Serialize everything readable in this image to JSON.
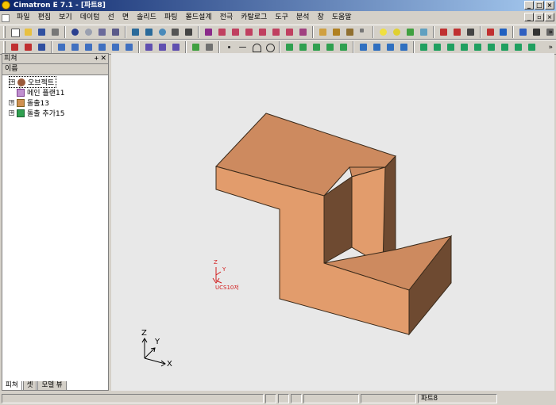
{
  "window": {
    "title": "Cimatron E 7.1 - [파트8]"
  },
  "menu": [
    "파일",
    "편집",
    "보기",
    "데이텀",
    "선",
    "면",
    "솔리드",
    "파팅",
    "몰드설계",
    "전극",
    "카탈로그",
    "도구",
    "분석",
    "창",
    "도움말"
  ],
  "panel": {
    "title": "피쳐",
    "column_header": "이름",
    "items": [
      {
        "label": "오브젝트",
        "icon": "object-icon",
        "expander": "+"
      },
      {
        "label": "메인 플랜11",
        "icon": "plane-icon",
        "expander": ""
      },
      {
        "label": "돌출13",
        "icon": "extrude-icon",
        "expander": "+"
      },
      {
        "label": "돌출 추가15",
        "icon": "extrude-add-icon",
        "expander": "+"
      }
    ],
    "tabs": [
      "피쳐",
      "셋",
      "모델 뷰"
    ],
    "active_tab": "피쳐"
  },
  "viewport": {
    "ucs_label": "UCS10저",
    "ucs_axes": {
      "z": "Z",
      "y": "Y"
    },
    "triad_axes": {
      "z": "Z",
      "y": "Y",
      "x": "X"
    },
    "model_colors": {
      "top": "#cd8a5f",
      "front": "#e29c6c",
      "side": "#6e4a31"
    }
  },
  "status": {
    "document": "파트8"
  },
  "colors": {
    "title_start": "#0a246a",
    "title_end": "#a6caf0",
    "face": "#d4d0c8",
    "ucs": "#d21e1e"
  }
}
